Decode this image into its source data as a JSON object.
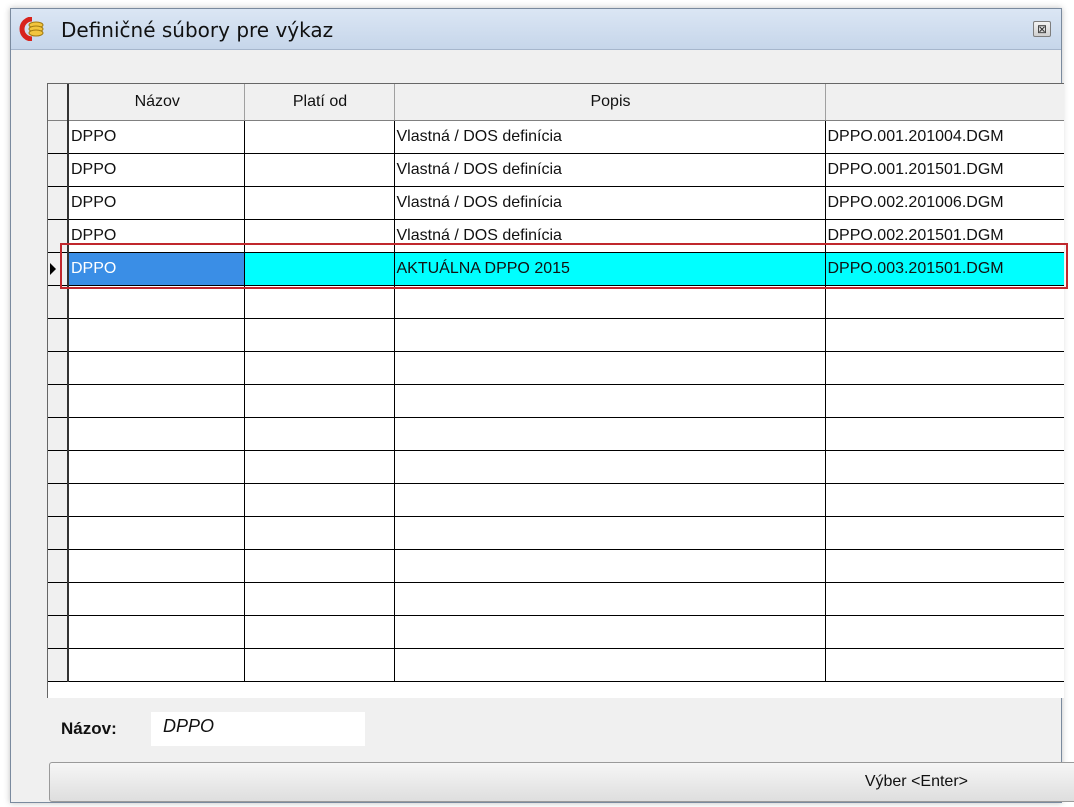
{
  "window": {
    "title": "Definičné súbory pre výkaz",
    "close_glyph": "⊠"
  },
  "grid": {
    "columns": [
      "Názov",
      "Platí od",
      "Popis",
      ""
    ],
    "rows": [
      {
        "nazov": "DPPO",
        "plati_od": "",
        "popis": "Vlastná / DOS definícia",
        "subor": "DPPO.001.201004.DGM"
      },
      {
        "nazov": "DPPO",
        "plati_od": "",
        "popis": "Vlastná / DOS definícia",
        "subor": "DPPO.001.201501.DGM"
      },
      {
        "nazov": "DPPO",
        "plati_od": "",
        "popis": "Vlastná / DOS definícia",
        "subor": "DPPO.002.201006.DGM"
      },
      {
        "nazov": "DPPO",
        "plati_od": "",
        "popis": "Vlastná / DOS definícia",
        "subor": "DPPO.002.201501.DGM"
      },
      {
        "nazov": "DPPO",
        "plati_od": "",
        "popis": "AKTUÁLNA DPPO 2015",
        "subor": "DPPO.003.201501.DGM"
      }
    ],
    "selected_row_index": 4,
    "selection_colors": {
      "first_cell": "#3a8ee6",
      "other_cells": "#00ffff",
      "frame": "#c0272d"
    },
    "empty_row_count": 12
  },
  "footer": {
    "name_label": "Názov:",
    "name_value": "DPPO",
    "select_button": "Výber <Enter>"
  },
  "icons": {
    "app": "coins-icon",
    "close": "close-icon",
    "row_pointer": "row-pointer-icon"
  }
}
